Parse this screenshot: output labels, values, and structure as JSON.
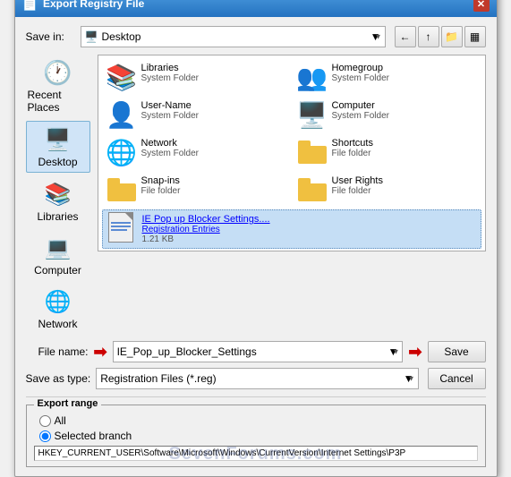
{
  "dialog": {
    "title": "Export Registry File",
    "title_icon": "📄"
  },
  "toolbar": {
    "save_in_label": "Save in:",
    "save_in_value": "Desktop",
    "back_btn": "←",
    "up_btn": "↑",
    "new_folder_btn": "📁",
    "view_btn": "▦"
  },
  "sidebar": {
    "items": [
      {
        "id": "recent-places",
        "label": "Recent Places",
        "active": false
      },
      {
        "id": "desktop",
        "label": "Desktop",
        "active": true
      },
      {
        "id": "libraries",
        "label": "Libraries",
        "active": false
      },
      {
        "id": "computer",
        "label": "Computer",
        "active": false
      },
      {
        "id": "network",
        "label": "Network",
        "active": false
      }
    ]
  },
  "files": [
    {
      "id": "libraries",
      "name": "Libraries",
      "type": "System Folder",
      "icon": "libraries"
    },
    {
      "id": "homegroup",
      "name": "Homegroup",
      "type": "System Folder",
      "icon": "homegroup"
    },
    {
      "id": "username",
      "name": "User-Name",
      "type": "System Folder",
      "icon": "user"
    },
    {
      "id": "computer",
      "name": "Computer",
      "type": "System Folder",
      "icon": "computer"
    },
    {
      "id": "network",
      "name": "Network",
      "type": "System Folder",
      "icon": "network"
    },
    {
      "id": "shortcuts",
      "name": "Shortcuts",
      "type": "File folder",
      "icon": "folder"
    },
    {
      "id": "snapins",
      "name": "Snap-ins",
      "type": "File folder",
      "icon": "folder"
    },
    {
      "id": "userrights",
      "name": "User Rights",
      "type": "File folder",
      "icon": "folder"
    },
    {
      "id": "iepop",
      "name": "IE Pop up Blocker Settings....",
      "type": "Registration Entries",
      "size": "1.21 KB",
      "icon": "regfile",
      "selected": true
    }
  ],
  "filename": {
    "label": "File name:",
    "value": "IE_Pop_up_Blocker_Settings",
    "save_label": "Save",
    "cancel_label": "Cancel"
  },
  "saveas": {
    "label": "Save as type:",
    "value": "Registration Files (*.reg)"
  },
  "export_range": {
    "title": "Export range",
    "options": [
      {
        "id": "all",
        "label": "All"
      },
      {
        "id": "selected",
        "label": "Selected branch"
      }
    ],
    "selected": "selected",
    "branch_value": "HKEY_CURRENT_USER\\Software\\Microsoft\\Windows\\CurrentVersion\\Internet Settings\\P3P"
  },
  "watermark": "SevenForums.com"
}
